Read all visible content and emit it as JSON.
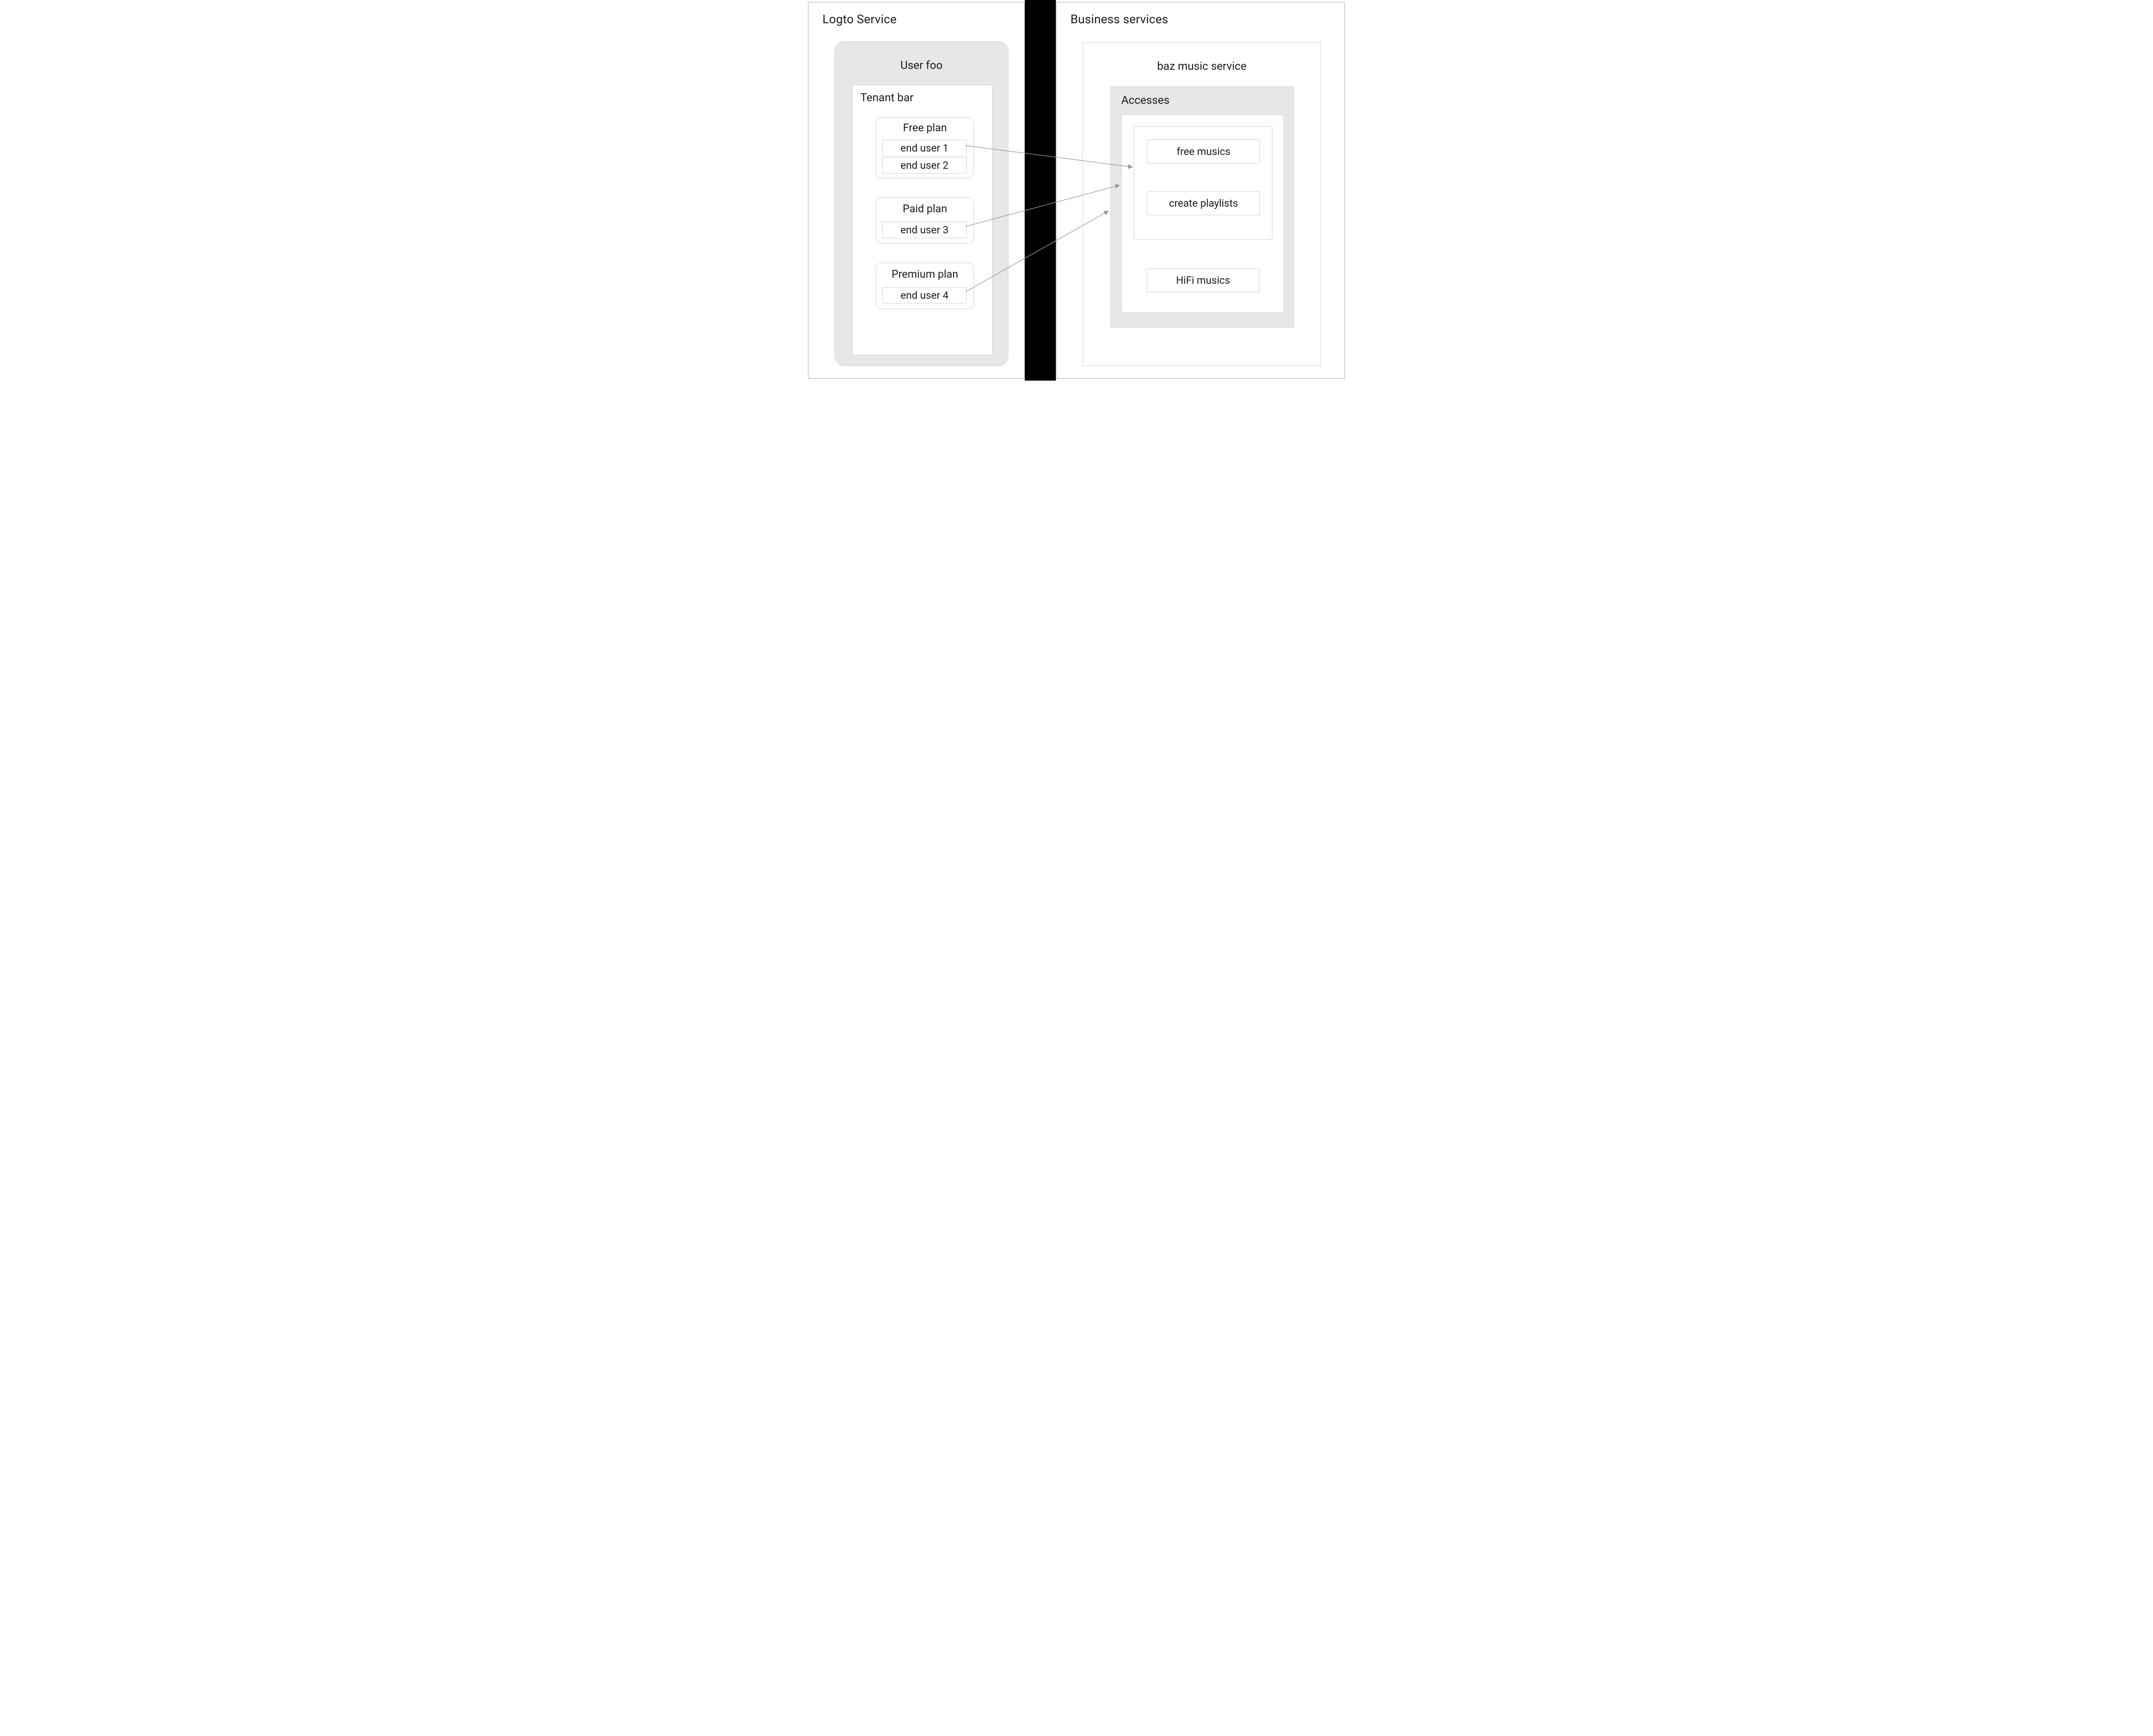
{
  "left_panel": {
    "title": "Logto Service",
    "user_box": {
      "title": "User foo",
      "tenant": {
        "title": "Tenant bar",
        "plans": [
          {
            "name": "Free plan",
            "users": [
              "end user 1",
              "end user 2"
            ]
          },
          {
            "name": "Paid plan",
            "users": [
              "end user 3"
            ]
          },
          {
            "name": "Premium plan",
            "users": [
              "end user 4"
            ]
          }
        ]
      }
    }
  },
  "right_panel": {
    "title": "Business services",
    "service_box": {
      "title": "baz music service",
      "accesses_title": "Accesses",
      "accesses": [
        "free musics",
        "create playlists",
        "HiFi musics"
      ]
    }
  }
}
